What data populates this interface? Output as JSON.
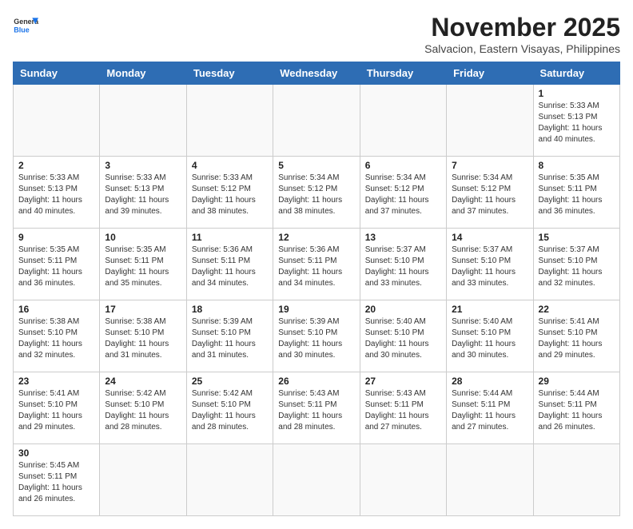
{
  "header": {
    "logo_line1": "General",
    "logo_line2": "Blue",
    "month_year": "November 2025",
    "location": "Salvacion, Eastern Visayas, Philippines"
  },
  "weekdays": [
    "Sunday",
    "Monday",
    "Tuesday",
    "Wednesday",
    "Thursday",
    "Friday",
    "Saturday"
  ],
  "days": [
    {
      "date": "",
      "info": ""
    },
    {
      "date": "",
      "info": ""
    },
    {
      "date": "",
      "info": ""
    },
    {
      "date": "",
      "info": ""
    },
    {
      "date": "",
      "info": ""
    },
    {
      "date": "",
      "info": ""
    },
    {
      "date": "1",
      "sunrise": "5:33 AM",
      "sunset": "5:13 PM",
      "daylight": "11 hours and 40 minutes."
    },
    {
      "date": "2",
      "sunrise": "5:33 AM",
      "sunset": "5:13 PM",
      "daylight": "11 hours and 40 minutes."
    },
    {
      "date": "3",
      "sunrise": "5:33 AM",
      "sunset": "5:13 PM",
      "daylight": "11 hours and 39 minutes."
    },
    {
      "date": "4",
      "sunrise": "5:33 AM",
      "sunset": "5:12 PM",
      "daylight": "11 hours and 38 minutes."
    },
    {
      "date": "5",
      "sunrise": "5:34 AM",
      "sunset": "5:12 PM",
      "daylight": "11 hours and 38 minutes."
    },
    {
      "date": "6",
      "sunrise": "5:34 AM",
      "sunset": "5:12 PM",
      "daylight": "11 hours and 37 minutes."
    },
    {
      "date": "7",
      "sunrise": "5:34 AM",
      "sunset": "5:12 PM",
      "daylight": "11 hours and 37 minutes."
    },
    {
      "date": "8",
      "sunrise": "5:35 AM",
      "sunset": "5:11 PM",
      "daylight": "11 hours and 36 minutes."
    },
    {
      "date": "9",
      "sunrise": "5:35 AM",
      "sunset": "5:11 PM",
      "daylight": "11 hours and 36 minutes."
    },
    {
      "date": "10",
      "sunrise": "5:35 AM",
      "sunset": "5:11 PM",
      "daylight": "11 hours and 35 minutes."
    },
    {
      "date": "11",
      "sunrise": "5:36 AM",
      "sunset": "5:11 PM",
      "daylight": "11 hours and 34 minutes."
    },
    {
      "date": "12",
      "sunrise": "5:36 AM",
      "sunset": "5:11 PM",
      "daylight": "11 hours and 34 minutes."
    },
    {
      "date": "13",
      "sunrise": "5:37 AM",
      "sunset": "5:10 PM",
      "daylight": "11 hours and 33 minutes."
    },
    {
      "date": "14",
      "sunrise": "5:37 AM",
      "sunset": "5:10 PM",
      "daylight": "11 hours and 33 minutes."
    },
    {
      "date": "15",
      "sunrise": "5:37 AM",
      "sunset": "5:10 PM",
      "daylight": "11 hours and 32 minutes."
    },
    {
      "date": "16",
      "sunrise": "5:38 AM",
      "sunset": "5:10 PM",
      "daylight": "11 hours and 32 minutes."
    },
    {
      "date": "17",
      "sunrise": "5:38 AM",
      "sunset": "5:10 PM",
      "daylight": "11 hours and 31 minutes."
    },
    {
      "date": "18",
      "sunrise": "5:39 AM",
      "sunset": "5:10 PM",
      "daylight": "11 hours and 31 minutes."
    },
    {
      "date": "19",
      "sunrise": "5:39 AM",
      "sunset": "5:10 PM",
      "daylight": "11 hours and 30 minutes."
    },
    {
      "date": "20",
      "sunrise": "5:40 AM",
      "sunset": "5:10 PM",
      "daylight": "11 hours and 30 minutes."
    },
    {
      "date": "21",
      "sunrise": "5:40 AM",
      "sunset": "5:10 PM",
      "daylight": "11 hours and 30 minutes."
    },
    {
      "date": "22",
      "sunrise": "5:41 AM",
      "sunset": "5:10 PM",
      "daylight": "11 hours and 29 minutes."
    },
    {
      "date": "23",
      "sunrise": "5:41 AM",
      "sunset": "5:10 PM",
      "daylight": "11 hours and 29 minutes."
    },
    {
      "date": "24",
      "sunrise": "5:42 AM",
      "sunset": "5:10 PM",
      "daylight": "11 hours and 28 minutes."
    },
    {
      "date": "25",
      "sunrise": "5:42 AM",
      "sunset": "5:10 PM",
      "daylight": "11 hours and 28 minutes."
    },
    {
      "date": "26",
      "sunrise": "5:43 AM",
      "sunset": "5:11 PM",
      "daylight": "11 hours and 28 minutes."
    },
    {
      "date": "27",
      "sunrise": "5:43 AM",
      "sunset": "5:11 PM",
      "daylight": "11 hours and 27 minutes."
    },
    {
      "date": "28",
      "sunrise": "5:44 AM",
      "sunset": "5:11 PM",
      "daylight": "11 hours and 27 minutes."
    },
    {
      "date": "29",
      "sunrise": "5:44 AM",
      "sunset": "5:11 PM",
      "daylight": "11 hours and 26 minutes."
    },
    {
      "date": "30",
      "sunrise": "5:45 AM",
      "sunset": "5:11 PM",
      "daylight": "11 hours and 26 minutes."
    },
    {
      "date": "",
      "info": ""
    },
    {
      "date": "",
      "info": ""
    },
    {
      "date": "",
      "info": ""
    },
    {
      "date": "",
      "info": ""
    },
    {
      "date": "",
      "info": ""
    },
    {
      "date": "",
      "info": ""
    }
  ],
  "labels": {
    "sunrise": "Sunrise:",
    "sunset": "Sunset:",
    "daylight": "Daylight:"
  }
}
